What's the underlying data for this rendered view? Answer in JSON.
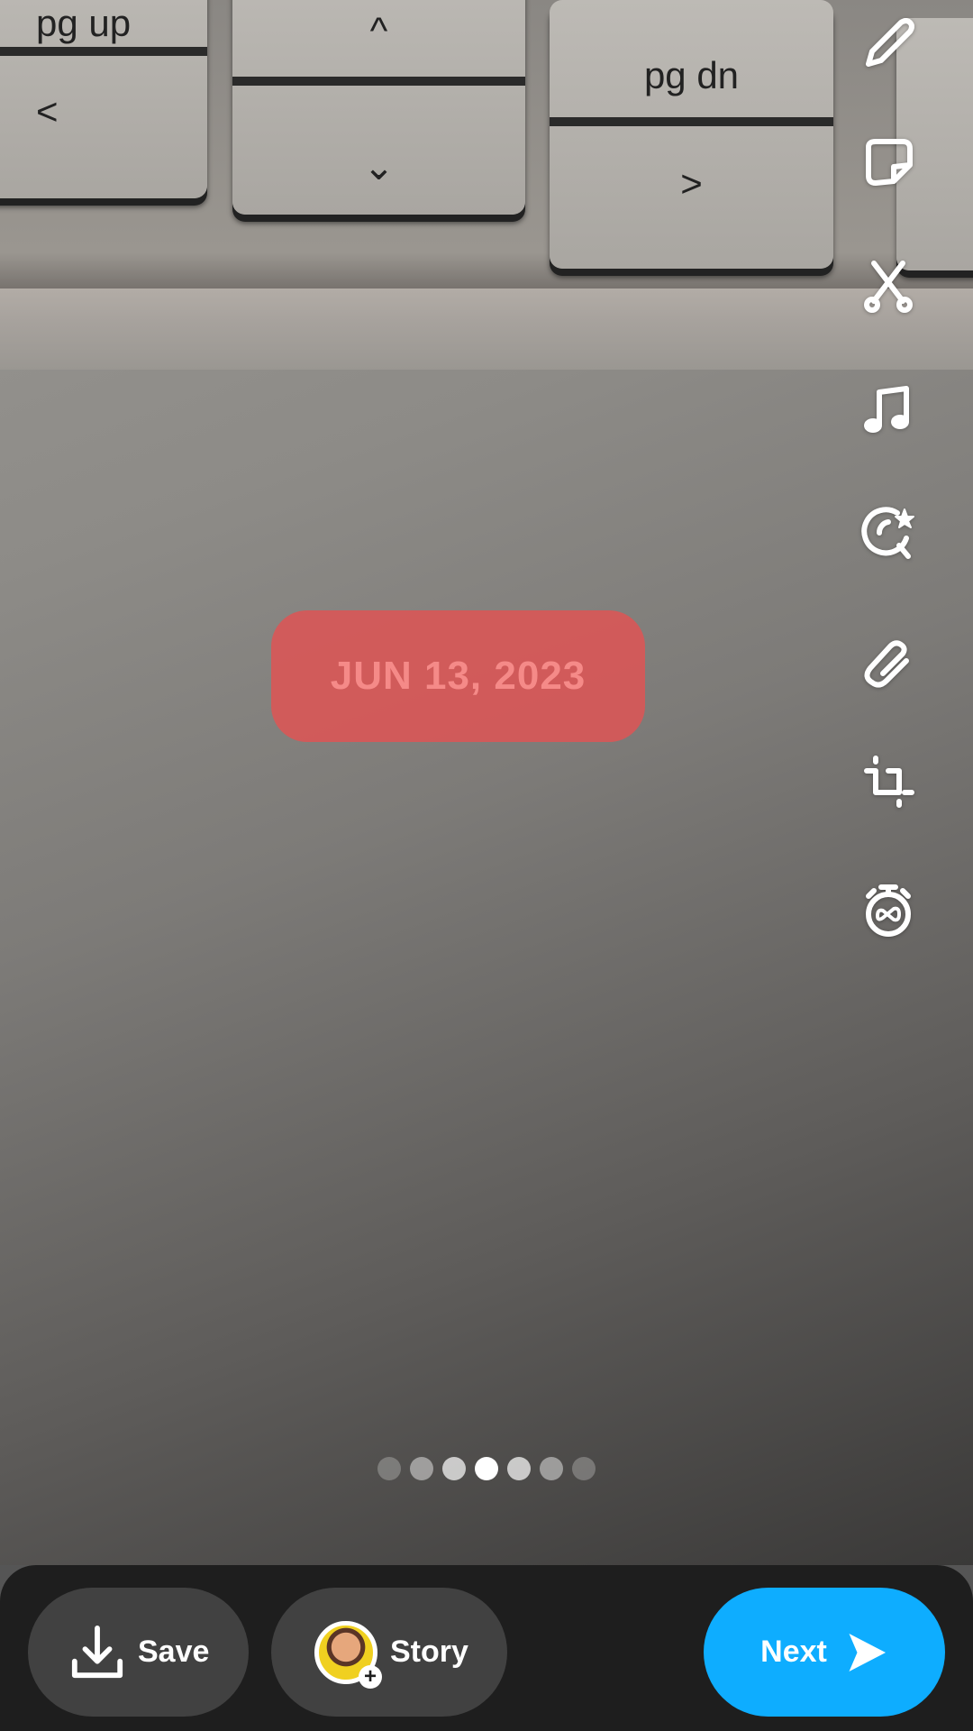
{
  "photo": {
    "keys": [
      "pg up",
      "pg dn"
    ]
  },
  "sticker": {
    "date": "JUN 13, 2023",
    "color": "#dc5555"
  },
  "toolbar": {
    "tools": [
      {
        "name": "pencil-icon"
      },
      {
        "name": "sticker-icon"
      },
      {
        "name": "scissors-icon"
      },
      {
        "name": "music-icon"
      },
      {
        "name": "lens-star-icon"
      },
      {
        "name": "paperclip-icon"
      },
      {
        "name": "crop-icon"
      },
      {
        "name": "timer-infinity-icon"
      }
    ]
  },
  "pager": {
    "count": 7,
    "active_index": 3
  },
  "bottom": {
    "save_label": "Save",
    "story_label": "Story",
    "next_label": "Next",
    "accent": "#0eadff"
  }
}
